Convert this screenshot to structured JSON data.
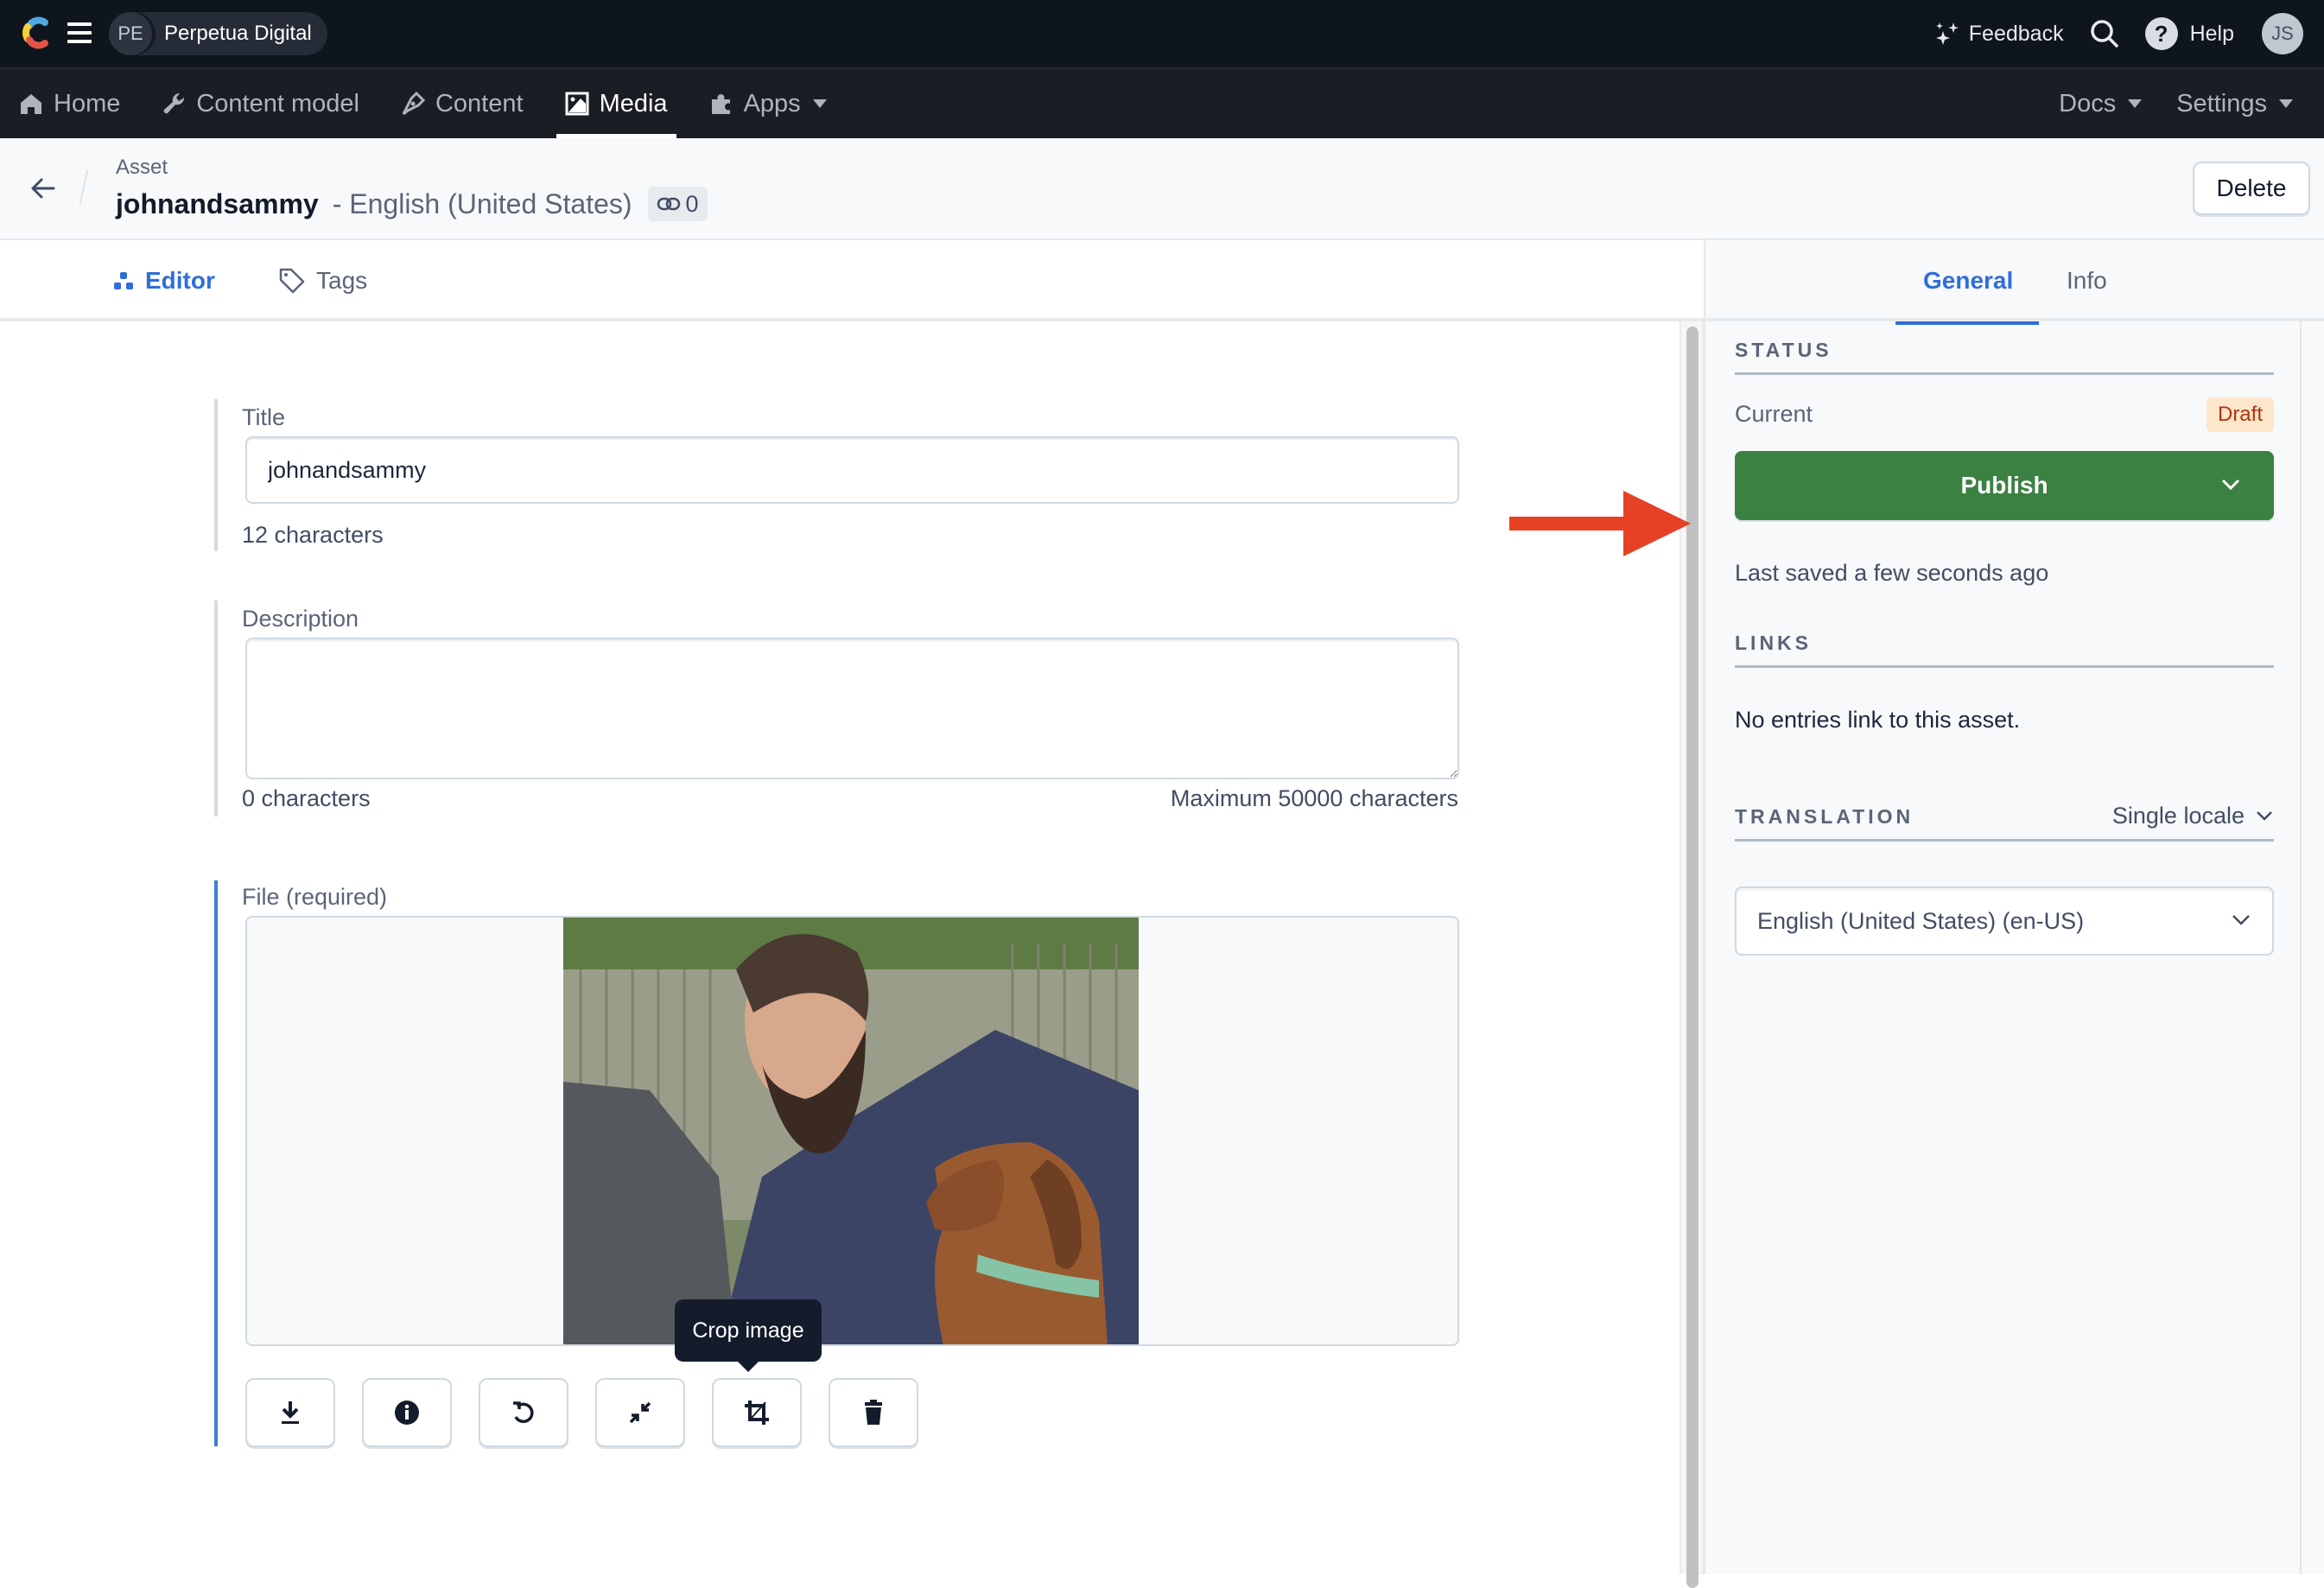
{
  "topbar": {
    "space_initials": "PE",
    "space_name": "Perpetua Digital",
    "feedback_label": "Feedback",
    "help_label": "Help",
    "user_initials": "JS"
  },
  "nav": {
    "items": [
      {
        "label": "Home",
        "icon": "home-icon"
      },
      {
        "label": "Content model",
        "icon": "wrench-icon"
      },
      {
        "label": "Content",
        "icon": "pen-icon"
      },
      {
        "label": "Media",
        "icon": "image-icon",
        "active": true
      },
      {
        "label": "Apps",
        "icon": "puzzle-icon",
        "dropdown": true
      }
    ],
    "right_items": [
      {
        "label": "Docs",
        "dropdown": true
      },
      {
        "label": "Settings",
        "dropdown": true
      }
    ]
  },
  "asset_header": {
    "kind": "Asset",
    "title": "johnandsammy",
    "locale": "- English (United States)",
    "links_count": "0",
    "delete_label": "Delete"
  },
  "editor_tabs": [
    {
      "label": "Editor",
      "active": true
    },
    {
      "label": "Tags",
      "active": false
    }
  ],
  "fields": {
    "title": {
      "label": "Title",
      "value": "johnandsammy",
      "char_count": "12 characters"
    },
    "description": {
      "label": "Description",
      "value": "",
      "char_count": "0 characters",
      "max_text": "Maximum 50000 characters"
    },
    "file": {
      "label": "File (required)",
      "actions": [
        {
          "name": "download",
          "icon": "download-icon"
        },
        {
          "name": "info",
          "icon": "info-icon"
        },
        {
          "name": "replace",
          "icon": "rotate-icon"
        },
        {
          "name": "resize",
          "icon": "compress-icon"
        },
        {
          "name": "crop",
          "icon": "crop-icon"
        },
        {
          "name": "delete",
          "icon": "trash-icon"
        }
      ],
      "tooltip": "Crop image"
    }
  },
  "sidebar": {
    "tabs": [
      {
        "label": "General",
        "active": true
      },
      {
        "label": "Info",
        "active": false
      }
    ],
    "status": {
      "heading": "STATUS",
      "current_label": "Current",
      "badge": "Draft",
      "publish_label": "Publish",
      "last_saved": "Last saved a few seconds ago"
    },
    "links": {
      "heading": "LINKS",
      "text": "No entries link to this asset."
    },
    "translation": {
      "heading": "TRANSLATION",
      "mode": "Single locale",
      "selected_locale": "English (United States) (en-US)"
    }
  },
  "colors": {
    "accent_blue": "#2f6ed9",
    "publish_green": "#3b8142",
    "draft_bg": "#fde6c9",
    "draft_text": "#b3320f",
    "annotation_arrow": "#e64125",
    "topbar_bg": "#0f151d"
  }
}
